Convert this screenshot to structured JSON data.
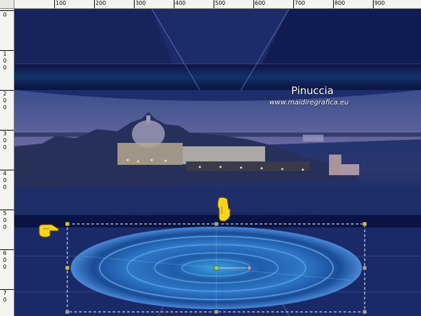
{
  "ruler": {
    "top_labels": [
      "100",
      "200",
      "300",
      "400",
      "500",
      "600",
      "700",
      "800",
      "900"
    ],
    "left_labels": [
      "0",
      "1",
      "0",
      "0",
      "2",
      "0",
      "0",
      "3",
      "0",
      "0",
      "4",
      "0",
      "0",
      "5",
      "0",
      "0",
      "6",
      "0",
      "0",
      "7",
      "0"
    ]
  },
  "watermark": {
    "title": "Pinuccia",
    "url": "www.maidiregrafica.eu"
  },
  "icons": {
    "pointer_top": "pointing-hand-down-icon",
    "pointer_left": "pointing-hand-right-icon"
  }
}
